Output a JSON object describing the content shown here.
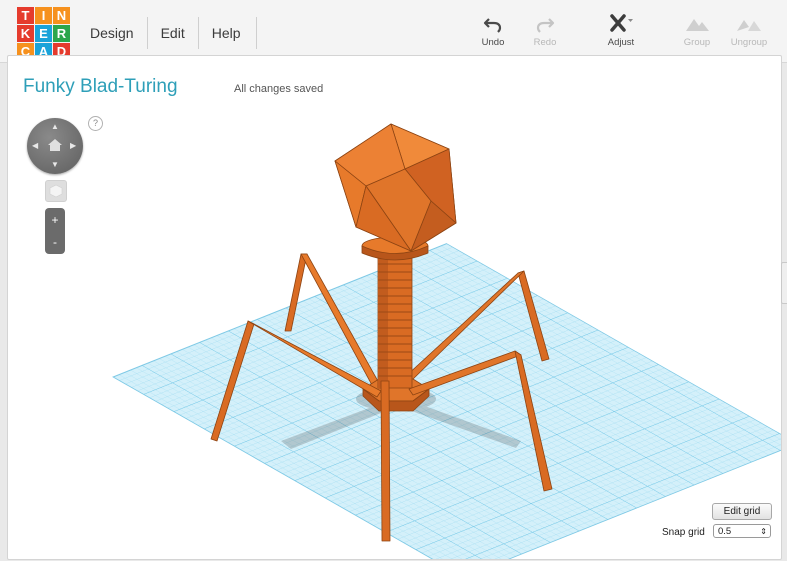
{
  "logo": {
    "letters": [
      "T",
      "I",
      "N",
      "K",
      "E",
      "R",
      "C",
      "A",
      "D"
    ],
    "colors": [
      "#e53b2d",
      "#f6911e",
      "#f6911e",
      "#e53b2d",
      "#1aa3d9",
      "#2ca64c",
      "#f6911e",
      "#1aa3d9",
      "#e53b2d"
    ]
  },
  "menu": {
    "design": "Design",
    "edit": "Edit",
    "help": "Help"
  },
  "toolbar": {
    "undo": "Undo",
    "redo": "Redo",
    "adjust": "Adjust",
    "group": "Group",
    "ungroup": "Ungroup"
  },
  "header": {
    "title": "Funky Blad-Turing",
    "status": "All changes saved"
  },
  "viewControls": {
    "help": "?",
    "zoomIn": "+",
    "zoomOut": "-"
  },
  "grid": {
    "editLabel": "Edit grid",
    "snapLabel": "Snap grid",
    "snapValue": "0.5"
  },
  "colors": {
    "accent": "#2e9fb8",
    "model": "#e0752a",
    "grid": "#aee3f4"
  }
}
